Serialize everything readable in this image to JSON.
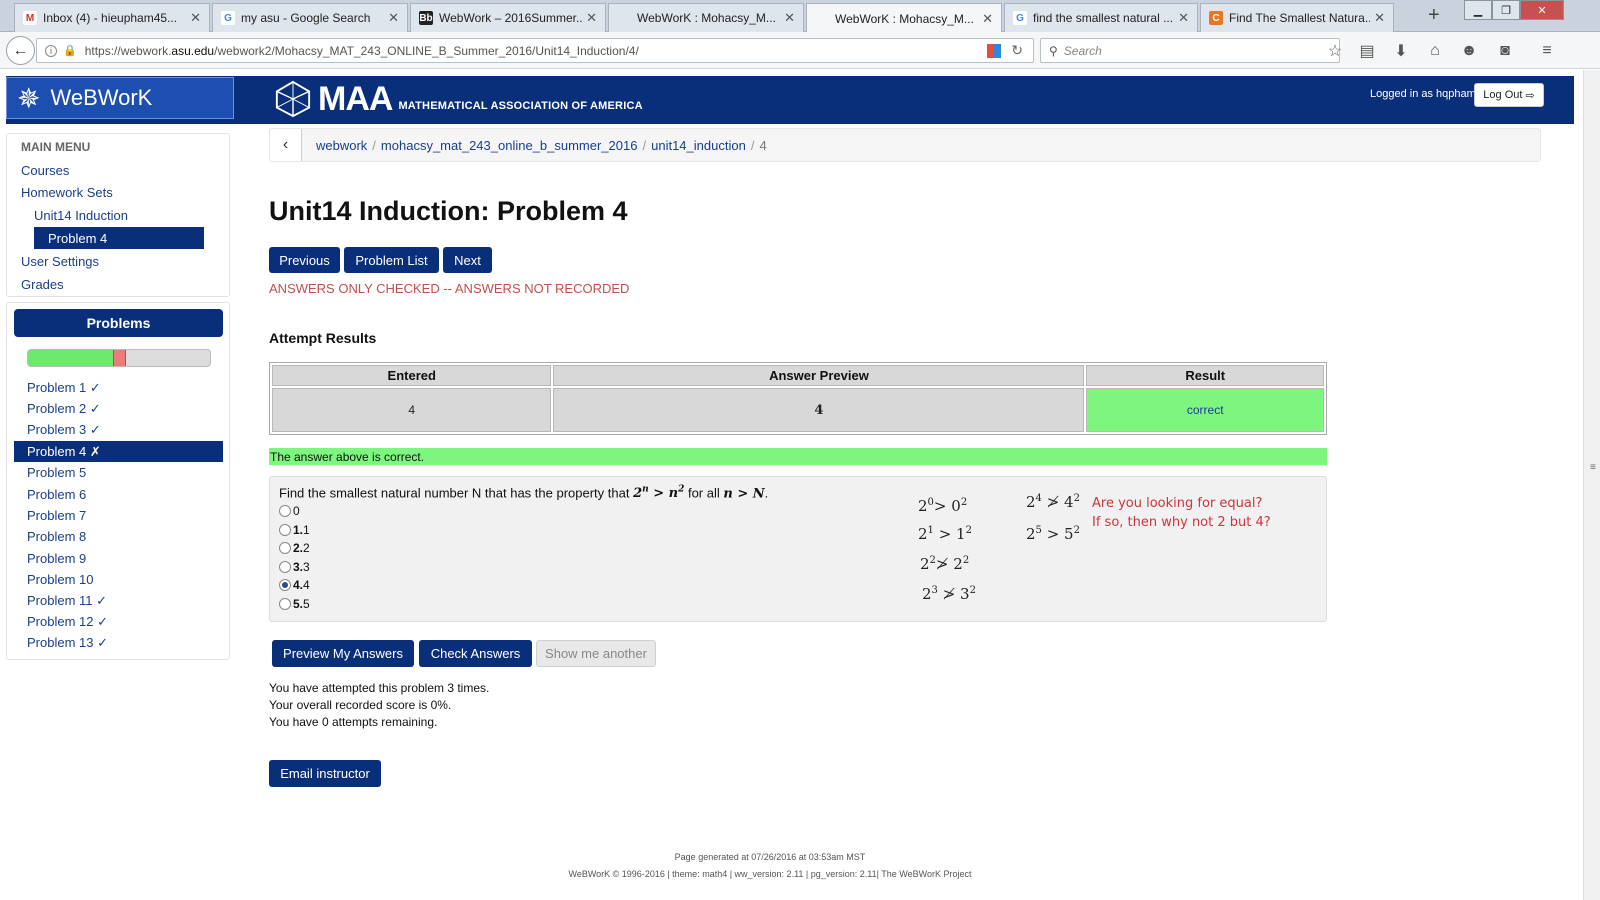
{
  "browser": {
    "tabs": [
      {
        "label": "Inbox (4) - hieupham45...",
        "icon": "gmail-icon",
        "fav": "M",
        "favbg": "#ffffff",
        "favcolor": "#d93025"
      },
      {
        "label": "my asu - Google Search",
        "icon": "google-icon",
        "fav": "G",
        "favbg": "#ffffff",
        "favcolor": "#4285f4"
      },
      {
        "label": "WebWork – 2016Summer...",
        "icon": "blackboard-icon",
        "fav": "Bb",
        "favbg": "#222222",
        "favcolor": "#ffffff"
      },
      {
        "label": "WebWorK : Mohacsy_M...",
        "icon": "page-icon",
        "fav": "",
        "favbg": "transparent",
        "favcolor": "#444"
      },
      {
        "label": "WebWorK : Mohacsy_M...",
        "icon": "page-icon",
        "fav": "",
        "favbg": "transparent",
        "favcolor": "#444"
      },
      {
        "label": "find the smallest natural ...",
        "icon": "google-icon",
        "fav": "G",
        "favbg": "#ffffff",
        "favcolor": "#4285f4"
      },
      {
        "label": "Find The Smallest Natura...",
        "icon": "chegg-icon",
        "fav": "C",
        "favbg": "#e87722",
        "favcolor": "#ffffff"
      }
    ],
    "url_prefix": "https://webwork.",
    "url_domain": "asu.edu",
    "url_path": "/webwork2/Mohacsy_MAT_243_ONLINE_B_Summer_2016/Unit14_Induction/4/",
    "search_placeholder": "Search"
  },
  "header": {
    "logo_text": "WeBWorK",
    "maa_big": "MAA",
    "maa_small": "MATHEMATICAL ASSOCIATION OF AMERICA",
    "logged_in": "Logged in as hqpham.",
    "logout_label": "Log Out"
  },
  "sidebar": {
    "title": "MAIN MENU",
    "courses": "Courses",
    "homework_sets": "Homework Sets",
    "set_name": "Unit14 Induction",
    "current_problem": "Problem 4",
    "user_settings": "User Settings",
    "grades": "Grades",
    "problems_title": "Problems",
    "progress": {
      "correct_fraction": 0.46,
      "incorrect_fraction": 0.07
    },
    "problems": [
      "Problem 1 ✓",
      "Problem 2 ✓",
      "Problem 3 ✓",
      "Problem 4 ✗",
      "Problem 5",
      "Problem 6",
      "Problem 7",
      "Problem 8",
      "Problem 9",
      "Problem 10",
      "Problem 11 ✓",
      "Problem 12 ✓",
      "Problem 13 ✓"
    ]
  },
  "breadcrumb": {
    "items": [
      "webwork",
      "mohacsy_mat_243_online_b_summer_2016",
      "unit14_induction"
    ],
    "current": "4"
  },
  "main": {
    "title": "Unit14 Induction: Problem 4",
    "nav_previous": "Previous",
    "nav_list": "Problem List",
    "nav_next": "Next",
    "notice": "ANSWERS ONLY CHECKED -- ANSWERS NOT RECORDED",
    "attempt_heading": "Attempt Results",
    "results": {
      "headers": [
        "Entered",
        "Answer Preview",
        "Result"
      ],
      "entered": "4",
      "preview": "4",
      "result": "correct"
    },
    "correct_message": "The answer above is correct.",
    "problem": {
      "prefix": "Find the smallest natural number N that has the property that ",
      "middle": " for all ",
      "options": [
        {
          "num": "",
          "label": "0",
          "selected": false
        },
        {
          "num": "1.",
          "label": " 1",
          "selected": false
        },
        {
          "num": "2.",
          "label": " 2",
          "selected": false
        },
        {
          "num": "3.",
          "label": " 3",
          "selected": false
        },
        {
          "num": "4.",
          "label": " 4",
          "selected": true
        },
        {
          "num": "5.",
          "label": " 5",
          "selected": false
        }
      ]
    },
    "annotation": {
      "line1": "Are you looking for equal?",
      "line2": "If so, then why not 2 but 4?"
    },
    "buttons": {
      "preview": "Preview My Answers",
      "check": "Check Answers",
      "another": "Show me another"
    },
    "attempts": [
      "You have attempted this problem 3 times.",
      "Your overall recorded score is 0%.",
      "You have 0 attempts remaining."
    ],
    "email": "Email instructor"
  },
  "footer": {
    "generated": "Page generated at 07/26/2016 at 03:53am MST",
    "credits": "WeBWorK © 1996-2016 | theme: math4 | ww_version: 2.11 | pg_version: 2.11| The WeBWorK Project"
  }
}
